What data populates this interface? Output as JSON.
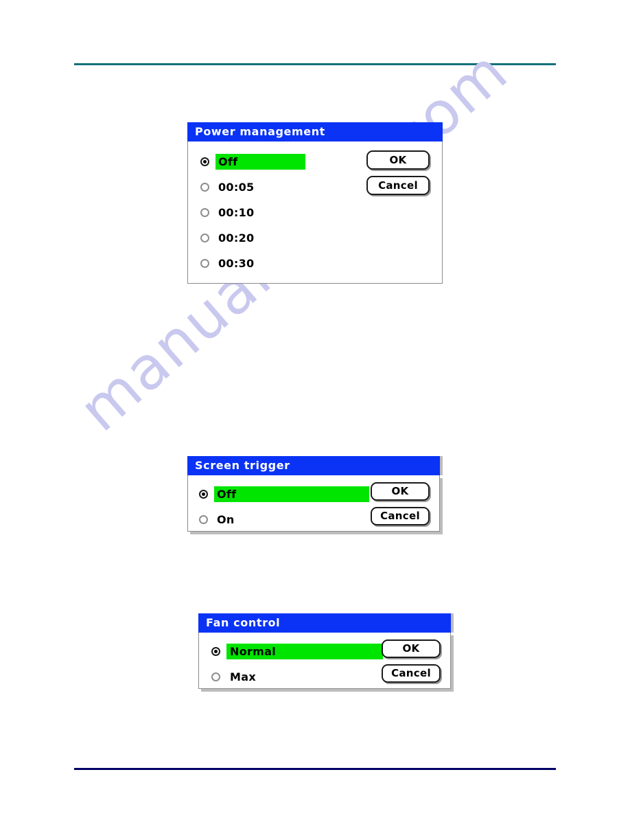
{
  "page": {
    "background_color": "#ffffff",
    "rule_top_color": "#14717a",
    "rule_bottom_color": "#000066",
    "watermark_text": "manualshive.com"
  },
  "theme": {
    "titlebar_color": "#0a33f5",
    "highlight_color": "#00e500",
    "dialog_border_color": "#8b8b8b",
    "shadow_color": "#bdbdbd",
    "text_color": "#000000"
  },
  "dialogs": [
    {
      "id": "power-management",
      "title": "Power management",
      "options": [
        {
          "label": "Off",
          "selected": true,
          "highlighted": true
        },
        {
          "label": "00:05",
          "selected": false,
          "highlighted": false
        },
        {
          "label": "00:10",
          "selected": false,
          "highlighted": false
        },
        {
          "label": "00:20",
          "selected": false,
          "highlighted": false
        },
        {
          "label": "00:30",
          "selected": false,
          "highlighted": false
        }
      ],
      "buttons": [
        {
          "label": "OK"
        },
        {
          "label": "Cancel"
        }
      ]
    },
    {
      "id": "screen-trigger",
      "title": "Screen trigger",
      "options": [
        {
          "label": "Off",
          "selected": true,
          "highlighted": true
        },
        {
          "label": "On",
          "selected": false,
          "highlighted": false
        }
      ],
      "buttons": [
        {
          "label": "OK"
        },
        {
          "label": "Cancel"
        }
      ]
    },
    {
      "id": "fan-control",
      "title": "Fan control",
      "options": [
        {
          "label": "Normal",
          "selected": true,
          "highlighted": true
        },
        {
          "label": "Max",
          "selected": false,
          "highlighted": false
        }
      ],
      "buttons": [
        {
          "label": "OK"
        },
        {
          "label": "Cancel"
        }
      ]
    }
  ]
}
